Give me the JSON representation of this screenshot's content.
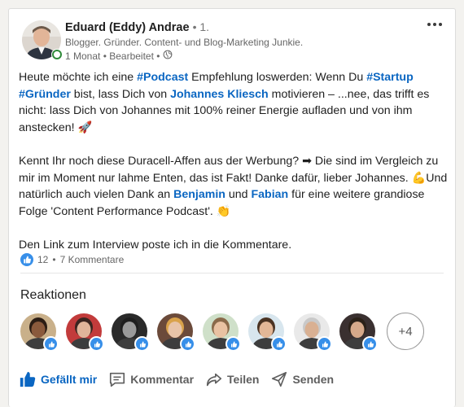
{
  "author": {
    "name": "Eduard (Eddy) Andrae",
    "degree": "• 1.",
    "headline": "Blogger. Gründer. Content- und Blog-Marketing Junkie.",
    "time": "1 Monat • Bearbeitet •",
    "online_color": "#2f8a3a"
  },
  "post": {
    "p1": {
      "t1": "Heute möchte ich eine ",
      "l1": "#Podcast",
      "t2": " Empfehlung loswerden: Wenn Du ",
      "l2": "#Startup",
      "l3": "#Gründer",
      "t3": " bist, lass Dich von ",
      "l4": "Johannes Kliesch",
      "t4": " motivieren – ...nee, das trifft es nicht: lass Dich von Johannes mit 100% reiner Energie aufladen und von ihm anstecken! 🚀"
    },
    "p2": {
      "t1": "Kennt Ihr noch diese Duracell-Affen aus der Werbung? ➡ Die sind im Vergleich zu mir im Moment nur lahme Enten, das ist Fakt! Danke dafür, lieber Johannes. 💪Und natürlich auch vielen Dank an ",
      "l1": "Benjamin",
      "t2": " und ",
      "l2": "Fabian",
      "t3": " für eine weitere grandiose Folge 'Content Performance Podcast'. 👏"
    },
    "p3": "Den Link zum Interview poste ich in die Kommentare."
  },
  "social": {
    "likes": "12",
    "separator": "•",
    "comments": "7 Kommentare"
  },
  "reactions": {
    "title": "Reaktionen",
    "more": "+4",
    "faces": [
      {
        "icon": "reactor-avatar-1",
        "skin": "#8a5a3c",
        "hair": "#2b1d14",
        "bg": "#c9b08a"
      },
      {
        "icon": "reactor-avatar-2",
        "skin": "#e0b59a",
        "hair": "#3a2520",
        "bg": "#c23b3b"
      },
      {
        "icon": "reactor-avatar-3",
        "skin": "#9a9a9a",
        "hair": "#1e1e1e",
        "bg": "#2a2a2a"
      },
      {
        "icon": "reactor-avatar-4",
        "skin": "#e8c4a8",
        "hair": "#d9a24a",
        "bg": "#6b4a3a"
      },
      {
        "icon": "reactor-avatar-5",
        "skin": "#e9c2a2",
        "hair": "#8a6a4a",
        "bg": "#cfe0c9"
      },
      {
        "icon": "reactor-avatar-6",
        "skin": "#e3b797",
        "hair": "#4a3323",
        "bg": "#d8e6ee"
      },
      {
        "icon": "reactor-avatar-7",
        "skin": "#d9b092",
        "hair": "#c9c9c9",
        "bg": "#e9e9e9"
      },
      {
        "icon": "reactor-avatar-8",
        "skin": "#d6a98a",
        "hair": "#2b2118",
        "bg": "#3a3030"
      }
    ]
  },
  "actions": {
    "like": "Gefällt mir",
    "comment": "Kommentar",
    "share": "Teilen",
    "send": "Senden"
  },
  "colors": {
    "link": "#0a66c2",
    "like_blue": "#378fe9"
  }
}
